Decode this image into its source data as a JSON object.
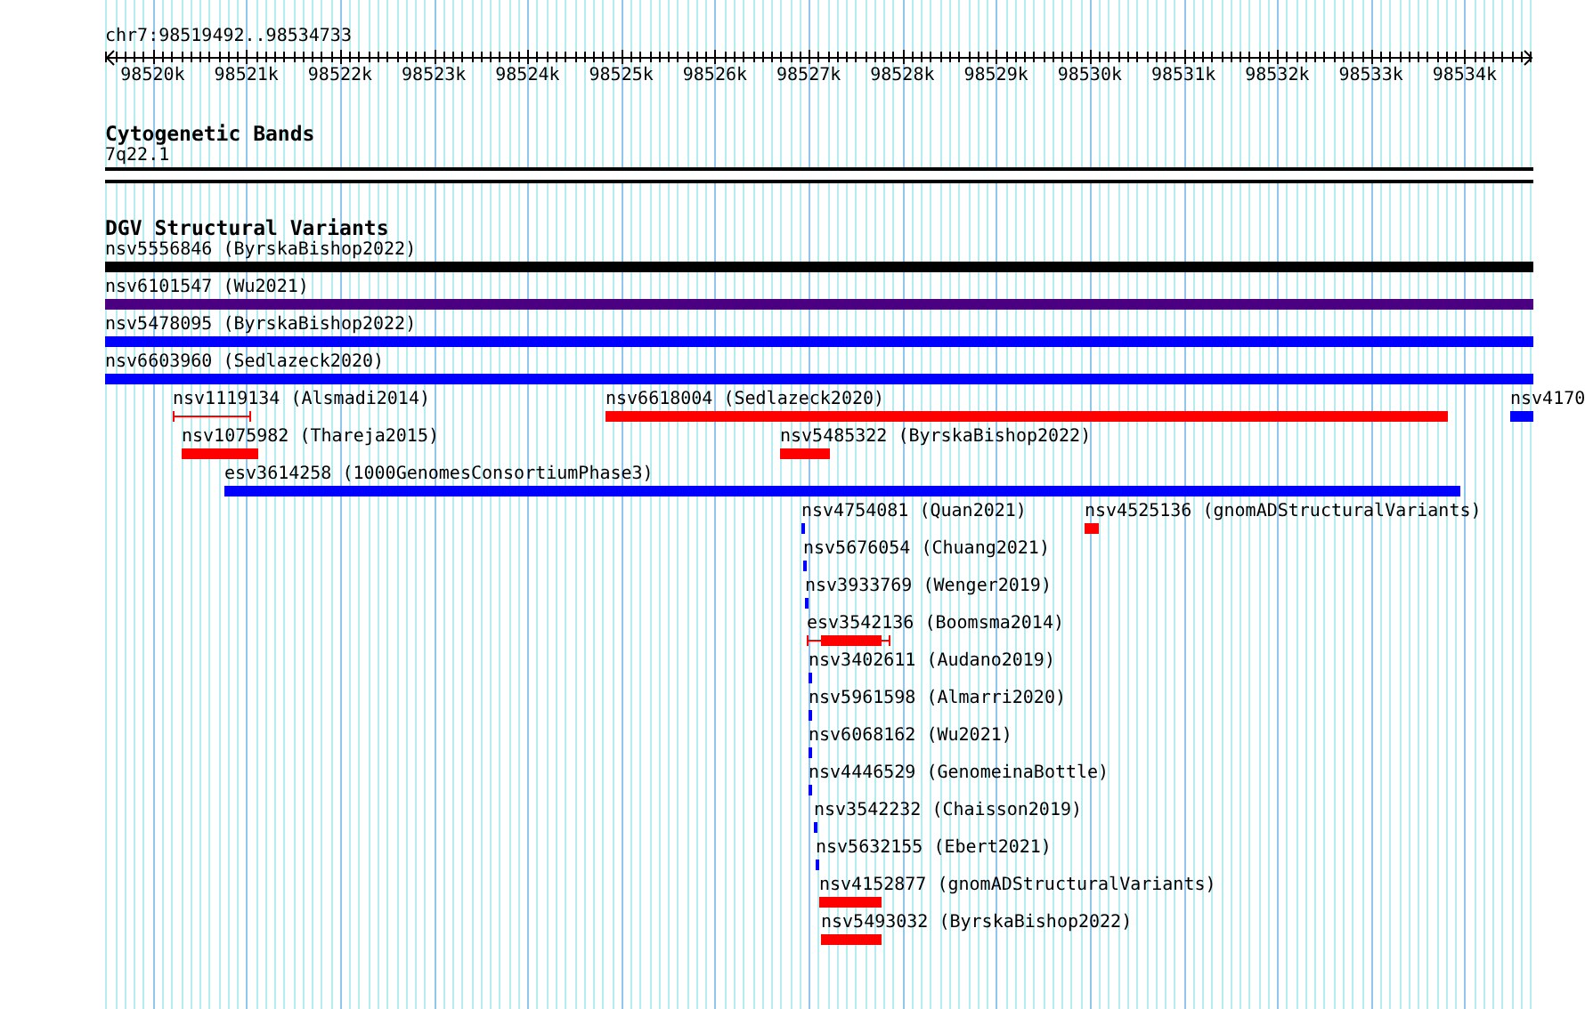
{
  "location": "chr7:98519492..98534733",
  "ruler": {
    "ticks": [
      "98520k",
      "98521k",
      "98522k",
      "98523k",
      "98524k",
      "98525k",
      "98526k",
      "98527k",
      "98528k",
      "98529k",
      "98530k",
      "98531k",
      "98532k",
      "98533k",
      "98534k"
    ]
  },
  "cytogenetic_bands": {
    "title": "Cytogenetic Bands",
    "band": "7q22.1"
  },
  "dgv_track": {
    "title": "DGV Structural Variants",
    "rows": [
      [
        {
          "label": "nsv5556846 (ByrskaBishop2022)",
          "kind": "solid",
          "color": "#000000"
        }
      ],
      [
        {
          "label": "nsv6101547 (Wu2021)",
          "kind": "solid",
          "color": "#4b0082"
        }
      ],
      [
        {
          "label": "nsv5478095 (ByrskaBishop2022)",
          "kind": "solid",
          "color": "#0000ff"
        }
      ],
      [
        {
          "label": "nsv6603960 (Sedlazeck2020)",
          "kind": "solid",
          "color": "#0000ff"
        }
      ],
      [
        {
          "label": "nsv1119134 (Alsmadi2014)",
          "kind": "interval",
          "color": "#ff0000"
        },
        {
          "label": "nsv6618004 (Sedlazeck2020)",
          "kind": "solid",
          "color": "#ff0000"
        },
        {
          "label": "nsv4170",
          "kind": "solid",
          "color": "#0000ff"
        }
      ],
      [
        {
          "label": "nsv1075982 (Thareja2015)",
          "kind": "solid",
          "color": "#ff0000"
        },
        {
          "label": "nsv5485322 (ByrskaBishop2022)",
          "kind": "solid",
          "color": "#ff0000"
        }
      ],
      [
        {
          "label": "esv3614258 (1000GenomesConsortiumPhase3)",
          "kind": "solid",
          "color": "#0000ff"
        }
      ],
      [
        {
          "label": "nsv4754081 (Quan2021)",
          "kind": "solid",
          "color": "#0000ff"
        },
        {
          "label": "nsv4525136 (gnomADStructuralVariants)",
          "kind": "solid",
          "color": "#ff0000"
        }
      ],
      [
        {
          "label": "nsv5676054 (Chuang2021)",
          "kind": "solid",
          "color": "#0000ff"
        }
      ],
      [
        {
          "label": "nsv3933769 (Wenger2019)",
          "kind": "solid",
          "color": "#0000ff"
        }
      ],
      [
        {
          "label": "esv3542136 (Boomsma2014)",
          "kind": "interval-core",
          "color": "#ff0000"
        }
      ],
      [
        {
          "label": "nsv3402611 (Audano2019)",
          "kind": "solid",
          "color": "#0000ff"
        }
      ],
      [
        {
          "label": "nsv5961598 (Almarri2020)",
          "kind": "solid",
          "color": "#0000ff"
        }
      ],
      [
        {
          "label": "nsv6068162 (Wu2021)",
          "kind": "solid",
          "color": "#0000ff"
        }
      ],
      [
        {
          "label": "nsv4446529 (GenomeinaBottle)",
          "kind": "solid",
          "color": "#0000ff"
        }
      ],
      [
        {
          "label": "nsv3542232 (Chaisson2019)",
          "kind": "solid",
          "color": "#0000ff"
        }
      ],
      [
        {
          "label": "nsv5632155 (Ebert2021)",
          "kind": "solid",
          "color": "#0000ff"
        }
      ],
      [
        {
          "label": "nsv4152877 (gnomADStructuralVariants)",
          "kind": "solid",
          "color": "#ff0000"
        }
      ],
      [
        {
          "label": "nsv5493032 (ByrskaBishop2022)",
          "kind": "solid",
          "color": "#ff0000"
        }
      ]
    ]
  }
}
